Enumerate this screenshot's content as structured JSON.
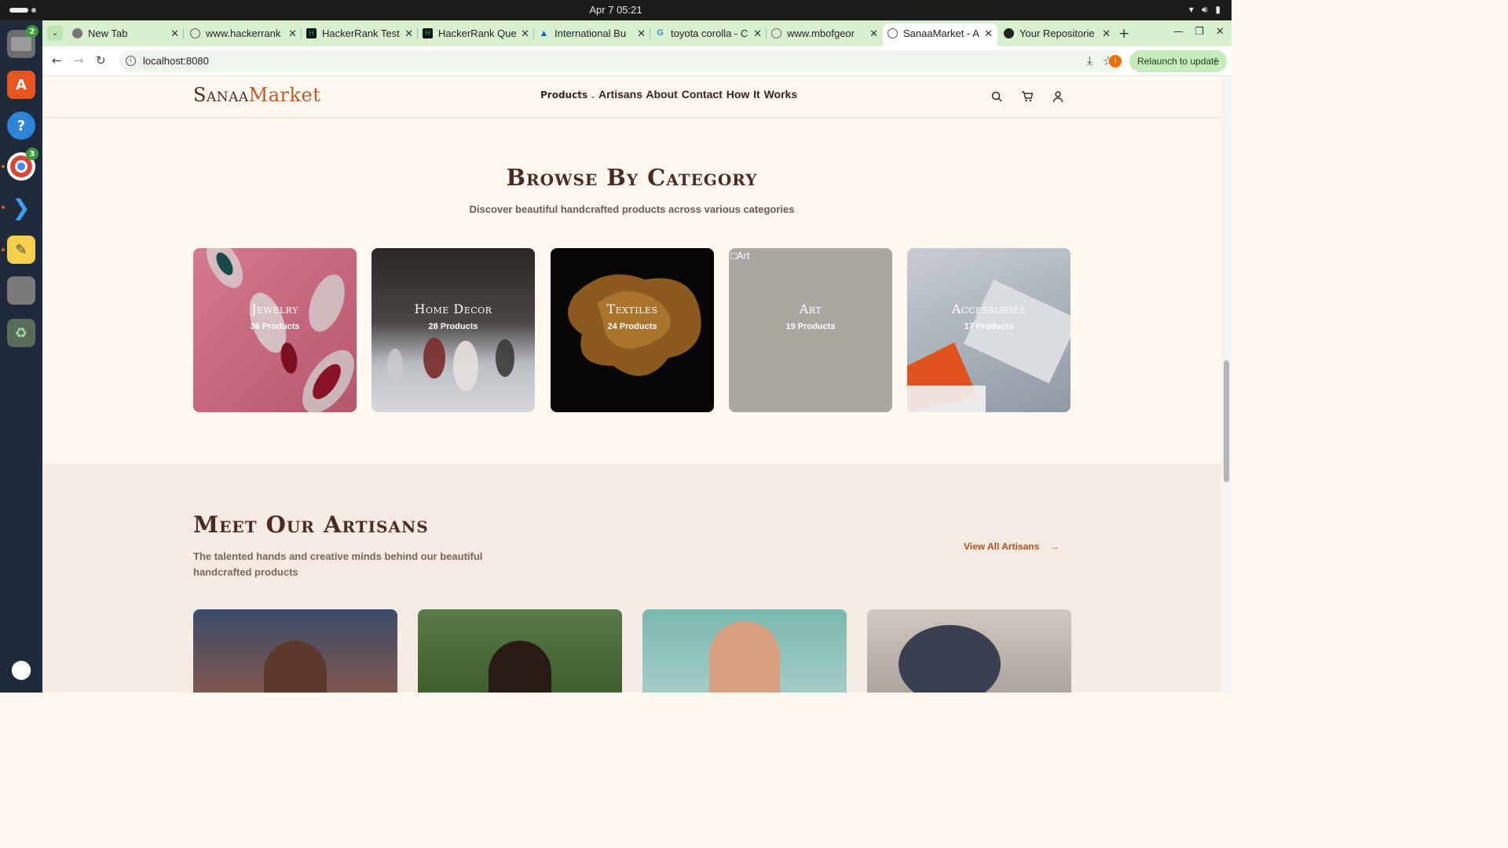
{
  "system": {
    "clock": "Apr 7  05:21"
  },
  "dock": {
    "files_badge": "2",
    "chrome_badge": "3"
  },
  "browser": {
    "tabs": [
      {
        "label": "New Tab"
      },
      {
        "label": "www.hackerrank"
      },
      {
        "label": "HackerRank Test"
      },
      {
        "label": "HackerRank Que"
      },
      {
        "label": "International Bu"
      },
      {
        "label": "toyota corolla - C"
      },
      {
        "label": "www.mbofgeor"
      },
      {
        "label": "SanaaMarket - A"
      },
      {
        "label": "Your Repositorie"
      }
    ],
    "url": "localhost:8080",
    "relaunch_label": "Relaunch to update",
    "profile_initial": "i"
  },
  "site": {
    "logo_part1": "Sanaa",
    "logo_part2": "Market",
    "nav": {
      "products": "Products",
      "rest": "Artisans About Contact How It Works"
    }
  },
  "browse": {
    "title": "Browse By Category",
    "subtitle": "Discover beautiful handcrafted products across various categories",
    "categories": [
      {
        "name": "Jewelry",
        "count": "36 Products",
        "color": "#c8677f"
      },
      {
        "name": "Home Decor",
        "count": "28 Products",
        "color": "#3a3838"
      },
      {
        "name": "Textiles",
        "count": "24 Products",
        "color": "#0d0a06"
      },
      {
        "name": "Art",
        "count": "19 Products",
        "color": "#aba69f",
        "broken_alt": "Art"
      },
      {
        "name": "Accessories",
        "count": "17 Products",
        "color": "#8f99a4"
      }
    ]
  },
  "artisans": {
    "title": "Meet Our Artisans",
    "subtitle": "The talented hands and creative minds behind our beautiful handcrafted products",
    "view_all": "View All Artisans"
  }
}
